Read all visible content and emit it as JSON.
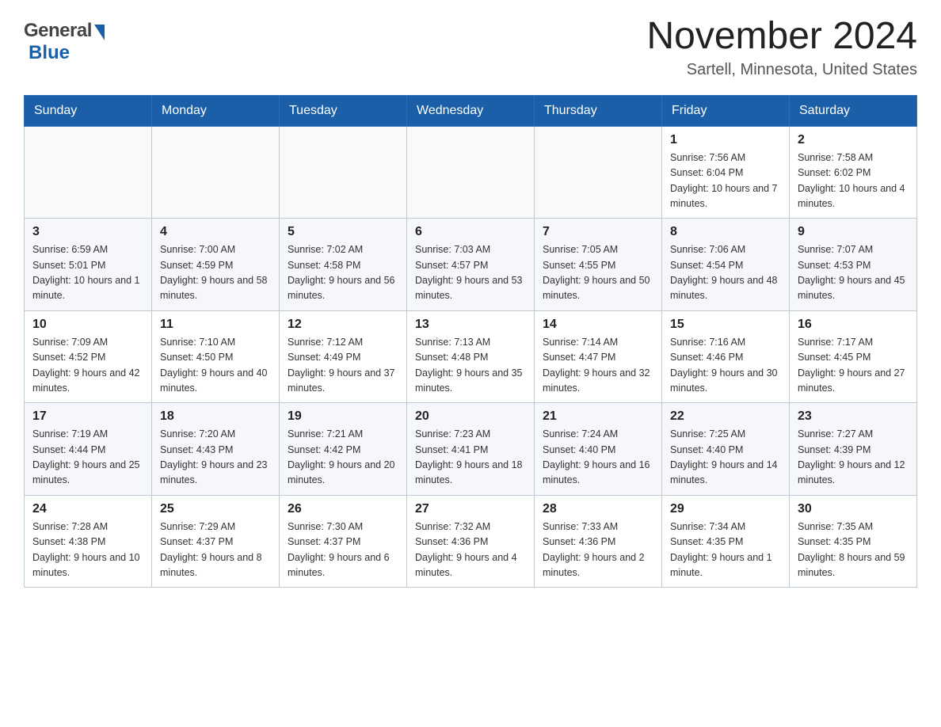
{
  "logo": {
    "general": "General",
    "blue": "Blue"
  },
  "title": "November 2024",
  "subtitle": "Sartell, Minnesota, United States",
  "days_of_week": [
    "Sunday",
    "Monday",
    "Tuesday",
    "Wednesday",
    "Thursday",
    "Friday",
    "Saturday"
  ],
  "weeks": [
    {
      "days": [
        {
          "num": "",
          "info": ""
        },
        {
          "num": "",
          "info": ""
        },
        {
          "num": "",
          "info": ""
        },
        {
          "num": "",
          "info": ""
        },
        {
          "num": "",
          "info": ""
        },
        {
          "num": "1",
          "info": "Sunrise: 7:56 AM\nSunset: 6:04 PM\nDaylight: 10 hours\nand 7 minutes."
        },
        {
          "num": "2",
          "info": "Sunrise: 7:58 AM\nSunset: 6:02 PM\nDaylight: 10 hours\nand 4 minutes."
        }
      ]
    },
    {
      "days": [
        {
          "num": "3",
          "info": "Sunrise: 6:59 AM\nSunset: 5:01 PM\nDaylight: 10 hours\nand 1 minute."
        },
        {
          "num": "4",
          "info": "Sunrise: 7:00 AM\nSunset: 4:59 PM\nDaylight: 9 hours\nand 58 minutes."
        },
        {
          "num": "5",
          "info": "Sunrise: 7:02 AM\nSunset: 4:58 PM\nDaylight: 9 hours\nand 56 minutes."
        },
        {
          "num": "6",
          "info": "Sunrise: 7:03 AM\nSunset: 4:57 PM\nDaylight: 9 hours\nand 53 minutes."
        },
        {
          "num": "7",
          "info": "Sunrise: 7:05 AM\nSunset: 4:55 PM\nDaylight: 9 hours\nand 50 minutes."
        },
        {
          "num": "8",
          "info": "Sunrise: 7:06 AM\nSunset: 4:54 PM\nDaylight: 9 hours\nand 48 minutes."
        },
        {
          "num": "9",
          "info": "Sunrise: 7:07 AM\nSunset: 4:53 PM\nDaylight: 9 hours\nand 45 minutes."
        }
      ]
    },
    {
      "days": [
        {
          "num": "10",
          "info": "Sunrise: 7:09 AM\nSunset: 4:52 PM\nDaylight: 9 hours\nand 42 minutes."
        },
        {
          "num": "11",
          "info": "Sunrise: 7:10 AM\nSunset: 4:50 PM\nDaylight: 9 hours\nand 40 minutes."
        },
        {
          "num": "12",
          "info": "Sunrise: 7:12 AM\nSunset: 4:49 PM\nDaylight: 9 hours\nand 37 minutes."
        },
        {
          "num": "13",
          "info": "Sunrise: 7:13 AM\nSunset: 4:48 PM\nDaylight: 9 hours\nand 35 minutes."
        },
        {
          "num": "14",
          "info": "Sunrise: 7:14 AM\nSunset: 4:47 PM\nDaylight: 9 hours\nand 32 minutes."
        },
        {
          "num": "15",
          "info": "Sunrise: 7:16 AM\nSunset: 4:46 PM\nDaylight: 9 hours\nand 30 minutes."
        },
        {
          "num": "16",
          "info": "Sunrise: 7:17 AM\nSunset: 4:45 PM\nDaylight: 9 hours\nand 27 minutes."
        }
      ]
    },
    {
      "days": [
        {
          "num": "17",
          "info": "Sunrise: 7:19 AM\nSunset: 4:44 PM\nDaylight: 9 hours\nand 25 minutes."
        },
        {
          "num": "18",
          "info": "Sunrise: 7:20 AM\nSunset: 4:43 PM\nDaylight: 9 hours\nand 23 minutes."
        },
        {
          "num": "19",
          "info": "Sunrise: 7:21 AM\nSunset: 4:42 PM\nDaylight: 9 hours\nand 20 minutes."
        },
        {
          "num": "20",
          "info": "Sunrise: 7:23 AM\nSunset: 4:41 PM\nDaylight: 9 hours\nand 18 minutes."
        },
        {
          "num": "21",
          "info": "Sunrise: 7:24 AM\nSunset: 4:40 PM\nDaylight: 9 hours\nand 16 minutes."
        },
        {
          "num": "22",
          "info": "Sunrise: 7:25 AM\nSunset: 4:40 PM\nDaylight: 9 hours\nand 14 minutes."
        },
        {
          "num": "23",
          "info": "Sunrise: 7:27 AM\nSunset: 4:39 PM\nDaylight: 9 hours\nand 12 minutes."
        }
      ]
    },
    {
      "days": [
        {
          "num": "24",
          "info": "Sunrise: 7:28 AM\nSunset: 4:38 PM\nDaylight: 9 hours\nand 10 minutes."
        },
        {
          "num": "25",
          "info": "Sunrise: 7:29 AM\nSunset: 4:37 PM\nDaylight: 9 hours\nand 8 minutes."
        },
        {
          "num": "26",
          "info": "Sunrise: 7:30 AM\nSunset: 4:37 PM\nDaylight: 9 hours\nand 6 minutes."
        },
        {
          "num": "27",
          "info": "Sunrise: 7:32 AM\nSunset: 4:36 PM\nDaylight: 9 hours\nand 4 minutes."
        },
        {
          "num": "28",
          "info": "Sunrise: 7:33 AM\nSunset: 4:36 PM\nDaylight: 9 hours\nand 2 minutes."
        },
        {
          "num": "29",
          "info": "Sunrise: 7:34 AM\nSunset: 4:35 PM\nDaylight: 9 hours\nand 1 minute."
        },
        {
          "num": "30",
          "info": "Sunrise: 7:35 AM\nSunset: 4:35 PM\nDaylight: 8 hours\nand 59 minutes."
        }
      ]
    }
  ]
}
